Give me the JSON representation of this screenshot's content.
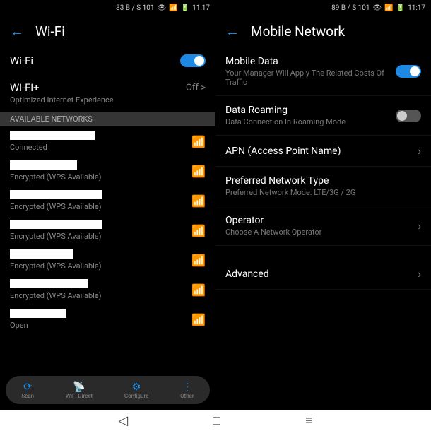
{
  "status": {
    "left": "33 B / S 101",
    "left2": "89 B / S 101",
    "time": "11:17"
  },
  "wifi": {
    "title": "Wi-Fi",
    "main_label": "Wi-Fi",
    "plus_label": "Wi-Fi+",
    "plus_sub": "Optimized Internet Experience",
    "plus_state": "Off >",
    "section": "AVAILABLE NETWORKS",
    "statuses": {
      "connected": "Connected",
      "wps": "Encrypted (WPS Available)",
      "open": "Open"
    },
    "bottom": {
      "scan": "Scan",
      "direct": "WiFi Direct",
      "configure": "Configure",
      "other": "Other"
    }
  },
  "mobile": {
    "title": "Mobile Network",
    "data_label": "Mobile Data",
    "data_desc": "Your Manager Will Apply The Related Costs Of Traffic",
    "roaming_label": "Data Roaming",
    "roaming_desc": "Data Connection In Roaming Mode",
    "apn": "APN (Access Point Name)",
    "pref_label": "Preferred Network Type",
    "pref_desc": "Preferred Network Mode: LTE/3G / 2G",
    "operator_label": "Operator",
    "operator_desc": "Choose A Network Operator",
    "advanced": "Advanced"
  }
}
